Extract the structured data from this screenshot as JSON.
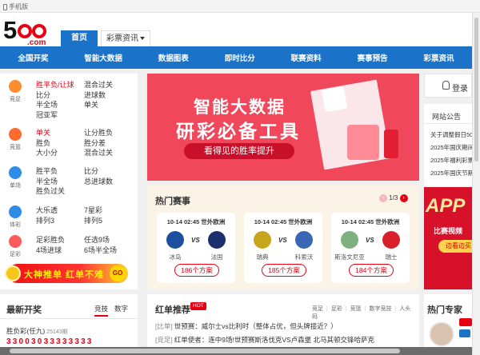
{
  "topbar": {
    "mobile_label": "手机版"
  },
  "header": {
    "logo_number": "5",
    "logo_suffix": ".com",
    "tab_home": "首页",
    "tab_news": "彩票资讯"
  },
  "nav": {
    "items": [
      "全国开奖",
      "智能大数据",
      "数据图表",
      "即时比分",
      "联赛资料",
      "赛事预告",
      "彩票资讯"
    ]
  },
  "left_sections": [
    {
      "icon_label": "竞足",
      "icon_color": "#ff8c2e",
      "col1": [
        "胜平负/让球",
        "比分",
        "半全场",
        "冠亚军"
      ],
      "col2": [
        "混合过关",
        "进球数",
        "单关",
        ""
      ]
    },
    {
      "icon_label": "竞篮",
      "icon_color": "#ff6a2e",
      "col1": [
        "单关",
        "胜负",
        "大小分"
      ],
      "col2": [
        "让分胜负",
        "胜分差",
        "混合过关"
      ]
    },
    {
      "icon_label": "单场",
      "icon_color": "#2e8ce6",
      "col1": [
        "胜平负",
        "半全场",
        "胜负过关"
      ],
      "col2": [
        "比分",
        "总进球数",
        ""
      ]
    },
    {
      "icon_label": "体彩",
      "icon_color": "#2e8ce6",
      "col1": [
        "大乐透",
        "排列3"
      ],
      "col2": [
        "7星彩",
        "排列5"
      ]
    },
    {
      "icon_label": "足彩",
      "icon_color": "#ff5a5a",
      "col1": [
        "足彩胜负",
        "4场进球"
      ],
      "col2": [
        "任选9场",
        "6场半全场"
      ]
    }
  ],
  "left_banner": {
    "text": "大神推单 红单不难",
    "go": "GO"
  },
  "hero": {
    "line1": "智能大数据",
    "line2": "研彩必备工具",
    "line3": "看得见的胜率提升"
  },
  "hot_matches": {
    "title": "热门赛事",
    "pager": "1/3",
    "prev": "‹",
    "next": "›",
    "vs": "VS",
    "matches": [
      {
        "time": "10-14 02:45 世外欧洲",
        "home": "冰岛",
        "away": "法国",
        "button": "186个方案",
        "home_color": "#1c4fa0",
        "away_color": "#1a2f6b"
      },
      {
        "time": "10-14 02:45 世外欧洲",
        "home": "瑞典",
        "away": "科索沃",
        "button": "185个方案",
        "home_color": "#c6a41c",
        "away_color": "#3a67b5"
      },
      {
        "time": "10-14 02:45 世外欧洲",
        "home": "斯洛文尼亚",
        "away": "瑞士",
        "button": "184个方案",
        "home_color": "#7fb07f",
        "away_color": "#d8202a"
      }
    ]
  },
  "right": {
    "login": "登录",
    "notice_title": "网站公告",
    "notices": [
      "关于调整假日500",
      "2025年国庆期间",
      "2025年福利彩票",
      "2025年国庆节期"
    ],
    "app_text": "APP",
    "app_sub": "比赛视频",
    "app_btn": "边看边买"
  },
  "latest": {
    "title": "最新开奖",
    "tabs": [
      "竞技",
      "数字"
    ],
    "game": "胜负彩(任九)",
    "issue": "25143期",
    "balls": "33003033333333"
  },
  "recommend": {
    "title": "红单推荐",
    "hot_badge": "HOT",
    "categories": [
      "竞足",
      "足彩",
      "竞篮",
      "数字竞技",
      "人头码"
    ],
    "items": [
      {
        "tag": "[比单]",
        "text": "世预赛：威尔士vs比利时（整体占优，但头牌接近？）"
      },
      {
        "tag": "[竞足]",
        "text": "红单使者：连中9场!世预赛斯洛伐克VS卢森堡 北马其顿交锋哈萨克"
      }
    ]
  },
  "experts": {
    "title": "热门专家"
  }
}
